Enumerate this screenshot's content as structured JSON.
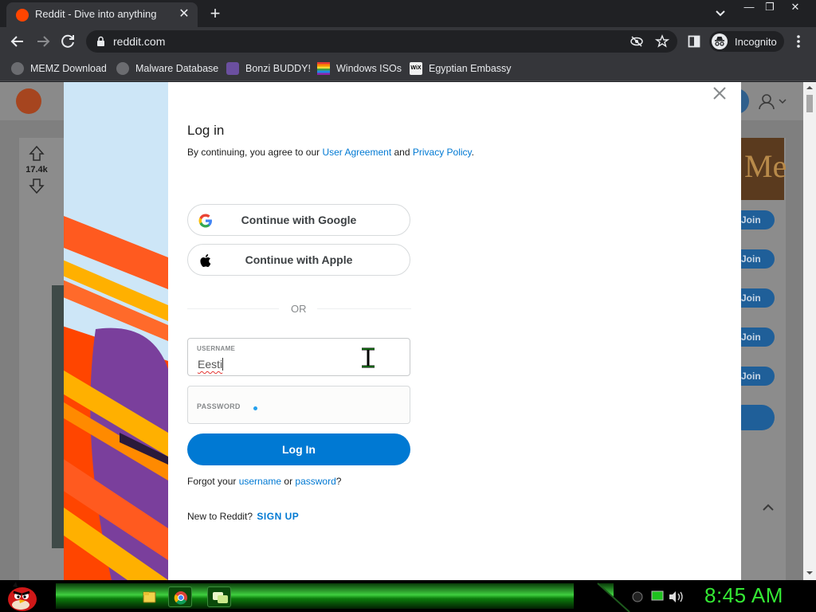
{
  "browser": {
    "tab_title": "Reddit - Dive into anything",
    "url": "reddit.com",
    "incognito_label": "Incognito",
    "bookmarks": [
      {
        "label": "MEMZ Download",
        "icon": "globe-icon"
      },
      {
        "label": "Malware Database",
        "icon": "globe-icon"
      },
      {
        "label": "Bonzi BUDDY!",
        "icon": "bonzi-icon"
      },
      {
        "label": "Windows ISOs",
        "icon": "windows-flag-icon"
      },
      {
        "label": "Egyptian Embassy",
        "icon": "wix-icon"
      }
    ]
  },
  "background_page": {
    "vote_count": "17.4k",
    "banner_text": "Me",
    "join_label": "Join"
  },
  "modal": {
    "title": "Log in",
    "agreement_prefix": "By continuing, you agree to our ",
    "user_agreement": "User Agreement",
    "and": " and ",
    "privacy_policy": "Privacy Policy",
    "period": ".",
    "google_button": "Continue with Google",
    "apple_button": "Continue with Apple",
    "or_divider": "OR",
    "username_label": "USERNAME",
    "username_value": "Eesti",
    "password_label": "PASSWORD",
    "login_button": "Log In",
    "forgot_prefix": "Forgot your ",
    "forgot_username": "username",
    "forgot_or": " or ",
    "forgot_password": "password",
    "forgot_suffix": "?",
    "new_prefix": "New to Reddit? ",
    "signup": "SIGN UP"
  },
  "taskbar": {
    "clock": "8:45 AM"
  },
  "colors": {
    "reddit_blue": "#0079d3",
    "reddit_orange": "#ff4500",
    "clock_green": "#34e834"
  }
}
